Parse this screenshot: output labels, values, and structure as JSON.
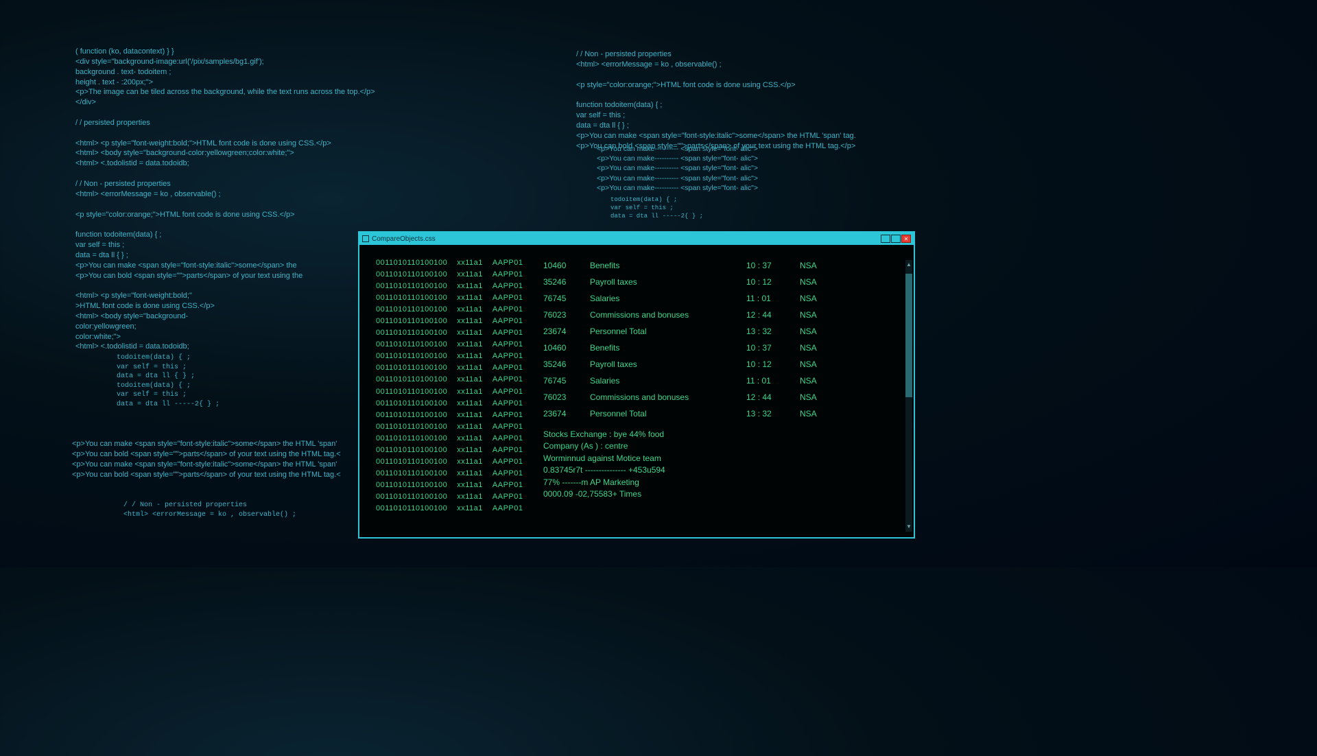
{
  "bg_left_top": [
    "( function  (ko, datacontext)  } }",
    " <div style=\"background-image:url('/pix/samples/bg1.gif');",
    "       background . text- todoitem ;",
    "       height . text - :200px;\">",
    "<p>The image can be tiled across the background, while the text runs across the top.</p>",
    "</div>",
    "",
    "/ /   persisted properties",
    "",
    "<html> <p style=\"font-weight:bold;\">HTML font code is done using CSS.</p>",
    "<html> <body style=\"background-color:yellowgreen;color:white;\">",
    "<html> <.todolistid = data.todoidb;",
    "",
    "  / / Non - persisted properties",
    "   <html> <errorMessage = ko , observable() ;",
    "",
    "<p style=\"color:orange;\">HTML font code is done using CSS.</p>",
    "",
    "   function  todoitem(data)  { ;",
    "       var  self = this ;",
    "       data = dta  ll { } ;",
    "<p>You can make <span style=\"font-style:italic\">some</span> the",
    "<p>You can bold <span style=\"\">parts</span> of your text using the",
    "",
    "<html> <p style=\"font-weight:bold;\"",
    ">HTML font code is done using CSS.</p>",
    "<html> <body style=\"background-",
    "color:yellowgreen;",
    "color:white;\">",
    "<html> <.todolistid = data.todoidb;"
  ],
  "bg_left_mid": [
    "todoitem(data) { ;",
    "var  self = this ;",
    "data = dta  ll { } ;",
    "todoitem(data) { ;",
    "var  self = this ;",
    "data = dta  ll -----2{ } ;"
  ],
  "bg_left_bot1": [
    "<p>You can make <span style=\"font-style:italic\">some</span> the HTML 'span'",
    "<p>You can bold <span style=\"\">parts</span> of your text using the HTML tag.<",
    "<p>You can make <span style=\"font-style:italic\">some</span> the HTML 'span'",
    "<p>You can bold <span style=\"\">parts</span> of your text using the HTML tag.<"
  ],
  "bg_left_bot2": [
    "/ / Non - persisted properties",
    "<html> <errorMessage = ko , observable() ;"
  ],
  "bg_right_top": [
    "/ / Non - persisted properties",
    " <html> <errorMessage = ko , observable() ;",
    "",
    "<p style=\"color:orange;\">HTML font code is done using CSS.</p>",
    "",
    "  function  todoitem(data)  { ;",
    "      var  self = this ;",
    "      data = dta  ll { } ;",
    "<p>You can make <span style=\"font-style:italic\">some</span> the HTML 'span' tag.",
    "<p>You can bold <span style=\"\">parts</span> of your text using the HTML tag.</p>"
  ],
  "bg_right_mid": [
    "<p>You can make----------  <span style=\"font- alic\">",
    "<p>You can make----------  <span style=\"font- alic\">",
    "<p>You can make----------  <span style=\"font- alic\">",
    "<p>You can make----------  <span style=\"font- alic\">",
    "<p>You can make----------  <span style=\"font- alic\">"
  ],
  "bg_right_code": [
    "todoitem(data) { ;",
    "var  self = this ;",
    "data = dta  ll -----2{ } ;"
  ],
  "window": {
    "title": "CompareObjects.css",
    "binary_rows": [
      {
        "bin": "0011010110100100",
        "c2": "xx11a1",
        "c3": "AAPP01"
      },
      {
        "bin": "0011010110100100",
        "c2": "xx11a1",
        "c3": "AAPP01"
      },
      {
        "bin": "0011010110100100",
        "c2": "xx11a1",
        "c3": "AAPP01"
      },
      {
        "bin": "0011010110100100",
        "c2": "xx11a1",
        "c3": "AAPP01"
      },
      {
        "bin": "0011010110100100",
        "c2": "xx11a1",
        "c3": "AAPP01"
      },
      {
        "bin": "0011010110100100",
        "c2": "xx11a1",
        "c3": "AAPP01"
      },
      {
        "bin": "0011010110100100",
        "c2": "xx11a1",
        "c3": "AAPP01"
      },
      {
        "bin": "0011010110100100",
        "c2": "xx11a1",
        "c3": "AAPP01"
      },
      {
        "bin": "0011010110100100",
        "c2": "xx11a1",
        "c3": "AAPP01"
      },
      {
        "bin": "0011010110100100",
        "c2": "xx11a1",
        "c3": "AAPP01"
      },
      {
        "bin": "0011010110100100",
        "c2": "xx11a1",
        "c3": "AAPP01"
      },
      {
        "bin": "0011010110100100",
        "c2": "xx11a1",
        "c3": "AAPP01"
      },
      {
        "bin": "0011010110100100",
        "c2": "xx11a1",
        "c3": "AAPP01"
      },
      {
        "bin": "0011010110100100",
        "c2": "xx11a1",
        "c3": "AAPP01"
      },
      {
        "bin": "0011010110100100",
        "c2": "xx11a1",
        "c3": "AAPP01"
      },
      {
        "bin": "0011010110100100",
        "c2": "xx11a1",
        "c3": "AAPP01"
      },
      {
        "bin": "0011010110100100",
        "c2": "xx11a1",
        "c3": "AAPP01"
      },
      {
        "bin": "0011010110100100",
        "c2": "xx11a1",
        "c3": "AAPP01"
      },
      {
        "bin": "0011010110100100",
        "c2": "xx11a1",
        "c3": "AAPP01"
      },
      {
        "bin": "0011010110100100",
        "c2": "xx11a1",
        "c3": "AAPP01"
      },
      {
        "bin": "0011010110100100",
        "c2": "xx11a1",
        "c3": "AAPP01"
      },
      {
        "bin": "0011010110100100",
        "c2": "xx11a1",
        "c3": "AAPP01"
      }
    ],
    "data_rows": [
      {
        "id": "10460",
        "desc": "Benefits",
        "time": "10 : 37",
        "tag": "NSA"
      },
      {
        "id": "35246",
        "desc": "Payroll taxes",
        "time": "10 : 12",
        "tag": "NSA"
      },
      {
        "id": "76745",
        "desc": "Salaries",
        "time": "11  : 01",
        "tag": "NSA"
      },
      {
        "id": "76023",
        "desc": "Commissions and bonuses",
        "time": "12 : 44",
        "tag": "NSA"
      },
      {
        "id": "23674",
        "desc": "Personnel Total",
        "time": "13 : 32",
        "tag": "NSA"
      },
      {
        "id": "10460",
        "desc": "Benefits",
        "time": "10  : 37",
        "tag": "NSA"
      },
      {
        "id": "35246",
        "desc": "Payroll taxes",
        "time": "10  : 12",
        "tag": "NSA"
      },
      {
        "id": "76745",
        "desc": "Salaries",
        "time": "11  : 01",
        "tag": "NSA"
      },
      {
        "id": "76023",
        "desc": "Commissions and bonuses",
        "time": "12 : 44",
        "tag": "NSA"
      },
      {
        "id": "23674",
        "desc": "Personnel Total",
        "time": "13 : 32",
        "tag": "NSA"
      }
    ],
    "stocks": [
      "Stocks Exchange : bye 44% food",
      "Company (As ) : centre",
      "Worminnud  against Motice team",
      "0.83745r7t   ---------------  +453u594",
      "77% -------m AP Marketing",
      "0000.09 -02,75583+ Times"
    ]
  }
}
